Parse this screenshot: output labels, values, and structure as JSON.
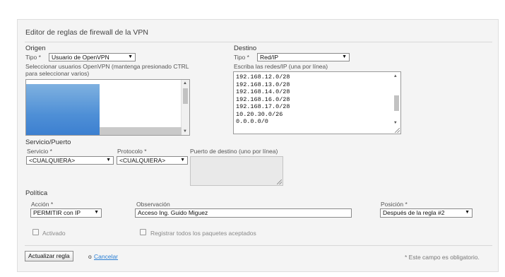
{
  "title": "Editor de reglas de firewall de la VPN",
  "origin": {
    "section": "Origen",
    "type_label": "Tipo *",
    "type_value": "Usuario de OpenVPN",
    "help": [
      "Seleccionar usuarios OpenVPN (mantenga presionado CTRL",
      "para seleccionar varios)"
    ]
  },
  "destination": {
    "section": "Destino",
    "type_label": "Tipo *",
    "type_value": "Red/IP",
    "help": "Escriba las redes/IP (una por línea)",
    "networks": [
      "192.168.12.0/28",
      "192.168.13.0/28",
      "192.168.14.0/28",
      "192.168.16.0/28",
      "192.168.17.0/28",
      "10.20.30.0/26",
      "0.0.0.0/0"
    ]
  },
  "service": {
    "section": "Servicio/Puerto",
    "service_label": "Servicio *",
    "service_value": "<CUALQUIERA>",
    "protocol_label": "Protocolo *",
    "protocol_value": "<CUALQUIERA>",
    "port_label": "Puerto de destino (uno por línea)"
  },
  "policy": {
    "section": "Política",
    "action_label": "Acción *",
    "action_value": "PERMITIR con IP",
    "remark_label": "Observación",
    "remark_value": "Acceso Ing. Guido Miguez",
    "position_label": "Posición *",
    "position_value": "Después de la regla #2",
    "enabled_label": "Activado",
    "log_label": "Registrar todos los paquetes aceptados"
  },
  "footer": {
    "update_button": "Actualizar regla",
    "or_text": "o",
    "cancel_link": "Cancelar",
    "required_note": "* Este campo es obligatorio."
  },
  "icons": {
    "dropdown": "chevron-down-icon",
    "scroll_up": "scroll-up-icon",
    "scroll_down": "scroll-down-icon",
    "resize": "resize-grip-icon"
  }
}
